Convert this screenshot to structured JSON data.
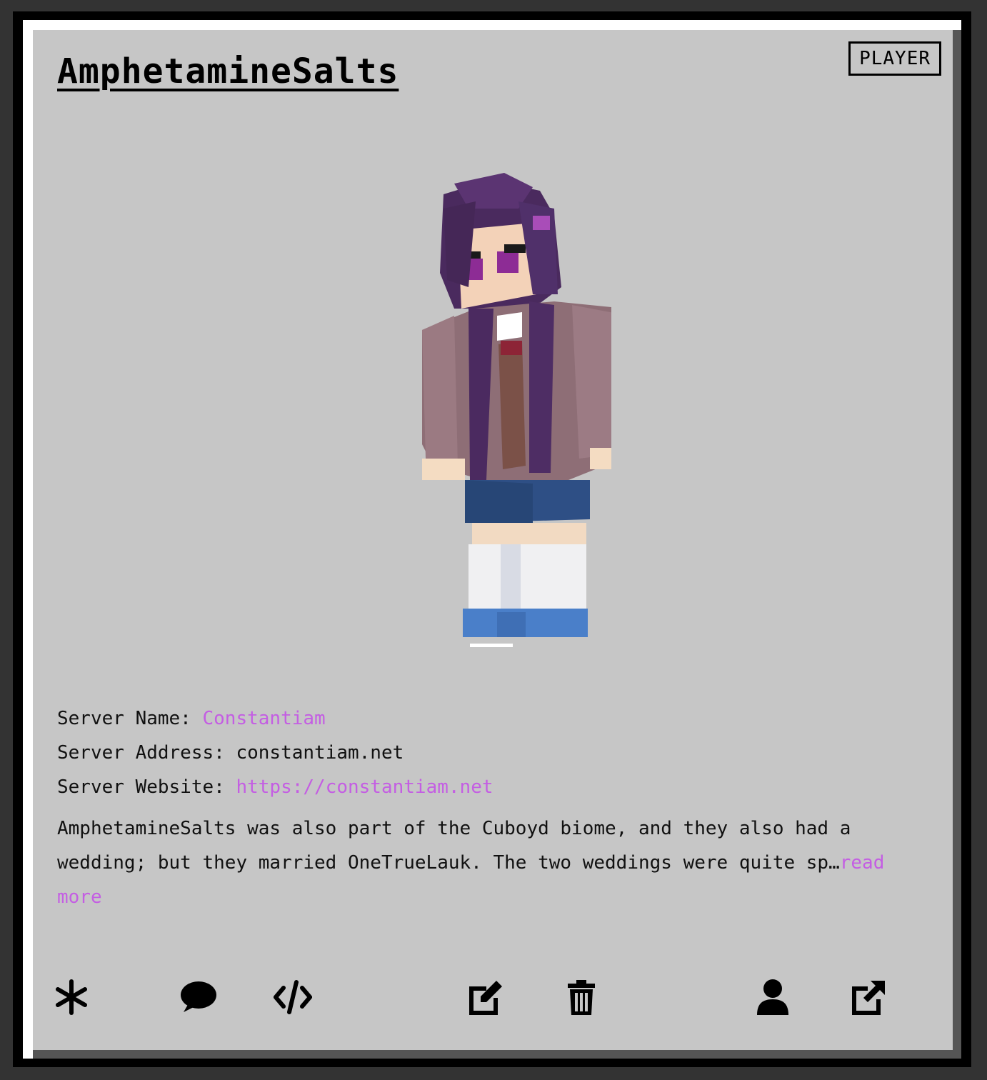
{
  "card": {
    "title": "AmphetamineSalts",
    "badge": "PLAYER"
  },
  "server": {
    "name_label": "Server Name:",
    "name_value": "Constantiam",
    "address_label": "Server Address:",
    "address_value": "constantiam.net",
    "website_label": "Server Website:",
    "website_value": "https://constantiam.net"
  },
  "description": {
    "text": "AmphetamineSalts was also part of the Cuboyd biome, and they also had a wedding; but they married OneTrueLauk. The two weddings were quite sp…",
    "more_label": "read more"
  },
  "actions": [
    {
      "icon": "asterisk-icon"
    },
    {
      "icon": "comment-icon"
    },
    {
      "icon": "code-icon"
    },
    {
      "icon": "edit-icon"
    },
    {
      "icon": "trash-icon"
    },
    {
      "icon": "user-icon"
    },
    {
      "icon": "external-link-icon"
    }
  ],
  "colors": {
    "page_bg": "#333333",
    "card_bg": "#c6c6c6",
    "link": "#c45ee3"
  }
}
